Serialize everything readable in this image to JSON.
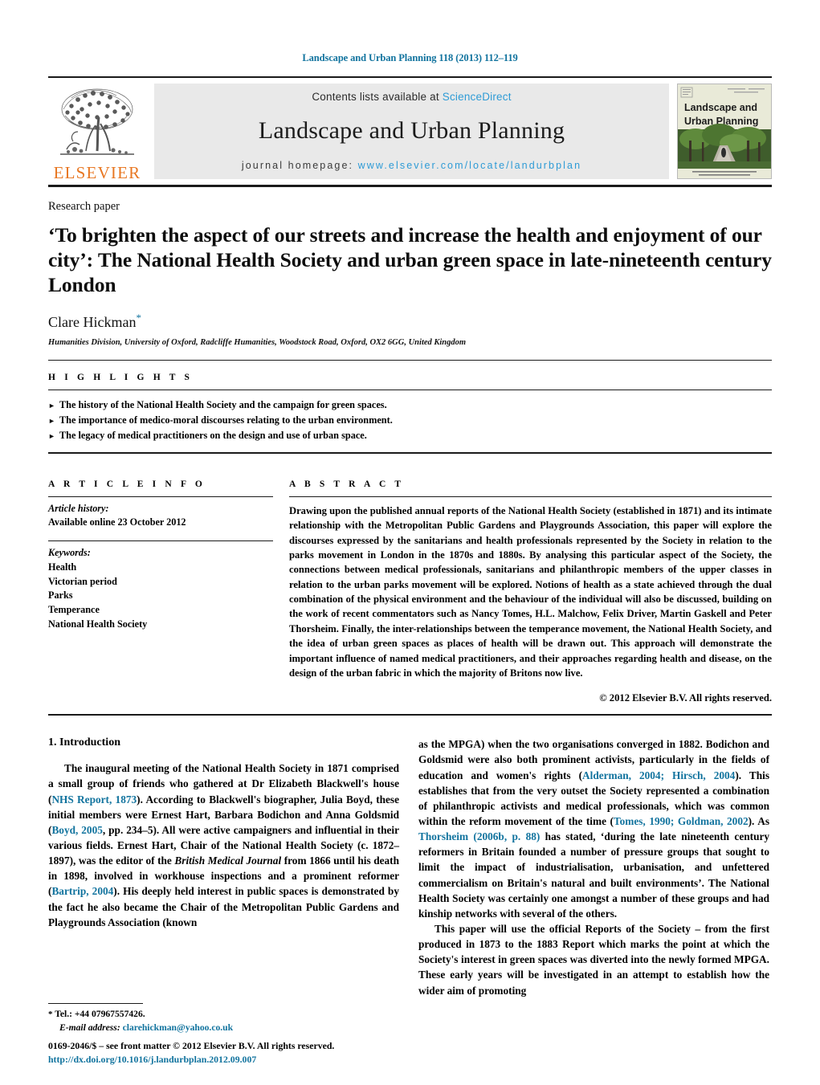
{
  "running_head": "Landscape and Urban Planning 118 (2013) 112–119",
  "masthead": {
    "contents_prefix": "Contents lists available at ",
    "sciencedirect": "ScienceDirect",
    "journal_name": "Landscape and Urban Planning",
    "homepage_prefix": "journal homepage: ",
    "homepage_url": "www.elsevier.com/locate/landurbplan",
    "publisher_wordmark": "ELSEVIER",
    "cover": {
      "line1": "Landscape and",
      "line2": "Urban Planning",
      "caption": "Special Issue: Interacting in Health – The Role of Urban Green Space"
    },
    "accent_link_color": "#2e9bd6",
    "elsevier_orange": "#e87722"
  },
  "article": {
    "doctype": "Research paper",
    "title": "‘To brighten the aspect of our streets and increase the health and enjoyment of our city’: The National Health Society and urban green space in late-nineteenth century London",
    "author": "Clare Hickman",
    "author_marker": "*",
    "affiliation": "Humanities Division, University of Oxford, Radcliffe Humanities, Woodstock Road, Oxford, OX2 6GG, United Kingdom",
    "link_color": "#11739e"
  },
  "highlights": {
    "label": "H I G H L I G H T S",
    "bullet_glyph": "►",
    "items": [
      "The history of the National Health Society and the campaign for green spaces.",
      "The importance of medico-moral discourses relating to the urban environment.",
      "The legacy of medical practitioners on the design and use of urban space."
    ]
  },
  "article_info": {
    "label": "A R T I C L E   I N F O",
    "history_head": "Article history:",
    "history_value": "Available online 23 October 2012",
    "keywords_head": "Keywords:",
    "keywords": [
      "Health",
      "Victorian period",
      "Parks",
      "Temperance",
      "National Health Society"
    ]
  },
  "abstract": {
    "label": "A B S T R A C T",
    "text": "Drawing upon the published annual reports of the National Health Society (established in 1871) and its intimate relationship with the Metropolitan Public Gardens and Playgrounds Association, this paper will explore the discourses expressed by the sanitarians and health professionals represented by the Society in relation to the parks movement in London in the 1870s and 1880s. By analysing this particular aspect of the Society, the connections between medical professionals, sanitarians and philanthropic members of the upper classes in relation to the urban parks movement will be explored. Notions of health as a state achieved through the dual combination of the physical environment and the behaviour of the individual will also be discussed, building on the work of recent commentators such as Nancy Tomes, H.L. Malchow, Felix Driver, Martin Gaskell and Peter Thorsheim. Finally, the inter-relationships between the temperance movement, the National Health Society, and the idea of urban green spaces as places of health will be drawn out. This approach will demonstrate the important influence of named medical practitioners, and their approaches regarding health and disease, on the design of the urban fabric in which the majority of Britons now live.",
    "copyright": "© 2012 Elsevier B.V. All rights reserved."
  },
  "body": {
    "section_heading": "1.  Introduction",
    "left_para_1_a": "The inaugural meeting of the National Health Society in 1871 comprised a small group of friends who gathered at Dr Elizabeth Blackwell's house (",
    "left_cite_1": "NHS Report, 1873",
    "left_para_1_b": "). According to Blackwell's biographer, Julia Boyd, these initial members were Ernest Hart, Barbara Bodichon and Anna Goldsmid (",
    "left_cite_2": "Boyd, 2005",
    "left_para_1_c": ", pp. 234–5). All were active campaigners and influential in their various fields. Ernest Hart, Chair of the National Health Society (c. 1872–1897), was the editor of the ",
    "left_italic_1": "British Medical Journal",
    "left_para_1_d": " from 1866 until his death in 1898, involved in workhouse inspections and a prominent reformer (",
    "left_cite_3": "Bartrip, 2004",
    "left_para_1_e": "). His deeply held interest in public spaces is demonstrated by the fact he also became the Chair of the Metropolitan Public Gardens and Playgrounds Association (known",
    "right_para_1_a": "as the MPGA) when the two organisations converged in 1882. Bodichon and Goldsmid were also both prominent activists, particularly in the fields of education and women's rights (",
    "right_cite_1": "Alderman, 2004; Hirsch, 2004",
    "right_para_1_b": "). This establishes that from the very outset the Society represented a combination of philanthropic activists and medical professionals, which was common within the reform movement of the time (",
    "right_cite_2": "Tomes, 1990; Goldman, 2002",
    "right_para_1_c": "). As ",
    "right_cite_3": "Thorsheim (2006b, p. 88)",
    "right_para_1_d": " has stated, ‘during the late nineteenth century reformers in Britain founded a number of pressure groups that sought to limit the impact of industrialisation, urbanisation, and unfettered commercialism on Britain's natural and built environments’. The National Health Society was certainly one amongst a number of these groups and had kinship networks with several of the others.",
    "right_para_2": "This paper will use the official Reports of the Society – from the first produced in 1873 to the 1883 Report which marks the point at which the Society's interest in green spaces was diverted into the newly formed MPGA. These early years will be investigated in an attempt to establish how the wider aim of promoting"
  },
  "footnote": {
    "marker": "*",
    "tel": "Tel.: +44 07967557426.",
    "email_label": "E-mail address:",
    "email": "clarehickman@yahoo.co.uk"
  },
  "footer": {
    "issn_line": "0169-2046/$ – see front matter © 2012 Elsevier B.V. All rights reserved.",
    "doi": "http://dx.doi.org/10.1016/j.landurbplan.2012.09.007"
  }
}
